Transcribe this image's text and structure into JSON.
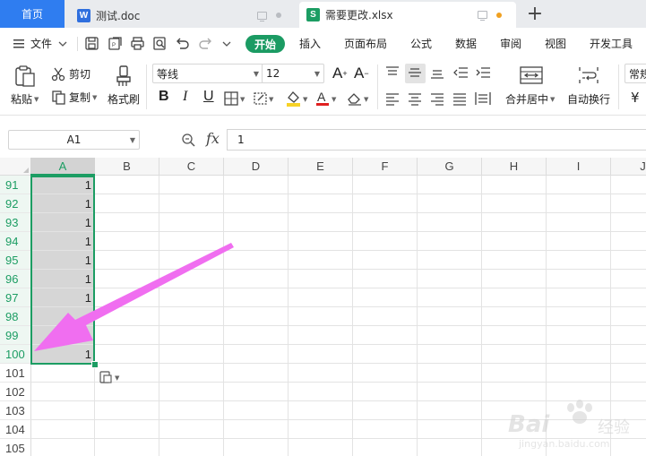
{
  "tabs": {
    "home": "首页",
    "doc_title": "测试.doc",
    "doc_icon": "W",
    "xlsx_title": "需要更改.xlsx",
    "xlsx_icon": "S"
  },
  "menu": {
    "file_label": "文件",
    "items": [
      "开始",
      "插入",
      "页面布局",
      "公式",
      "数据",
      "审阅",
      "视图",
      "开发工具"
    ]
  },
  "ribbon": {
    "paste": "粘贴",
    "cut": "剪切",
    "copy": "复制",
    "format_painter": "格式刷",
    "font_name": "等线",
    "font_size": "12",
    "merge_center": "合并居中",
    "wrap_text": "自动换行",
    "number_format": "常规",
    "currency_symbol": "¥"
  },
  "formula_bar": {
    "cell_ref": "A1",
    "fx": "fx",
    "value": "1"
  },
  "sheet": {
    "columns": [
      "A",
      "B",
      "C",
      "D",
      "E",
      "F",
      "G",
      "H",
      "I",
      "J"
    ],
    "selected_column": "A",
    "rows": [
      {
        "num": "91",
        "a": "1"
      },
      {
        "num": "92",
        "a": "1"
      },
      {
        "num": "93",
        "a": "1"
      },
      {
        "num": "94",
        "a": "1"
      },
      {
        "num": "95",
        "a": "1"
      },
      {
        "num": "96",
        "a": "1"
      },
      {
        "num": "97",
        "a": "1"
      },
      {
        "num": "98",
        "a": ""
      },
      {
        "num": "99",
        "a": "1"
      },
      {
        "num": "100",
        "a": "1"
      },
      {
        "num": "101",
        "a": ""
      },
      {
        "num": "102",
        "a": ""
      },
      {
        "num": "103",
        "a": ""
      },
      {
        "num": "104",
        "a": ""
      },
      {
        "num": "105",
        "a": ""
      }
    ],
    "selected_rows": 10
  },
  "watermark": {
    "logo": "Bai",
    "logo_cn": "经验",
    "url": "jingyan.baidu.com"
  },
  "colors": {
    "accent_green": "#1c9d63",
    "home_tab_blue": "#2f7df0",
    "doc_icon_blue": "#2f6fde",
    "arrow_magenta": "#f06ef0",
    "font_color_red": "#e02020",
    "fill_color_yellow": "#f7d226"
  }
}
